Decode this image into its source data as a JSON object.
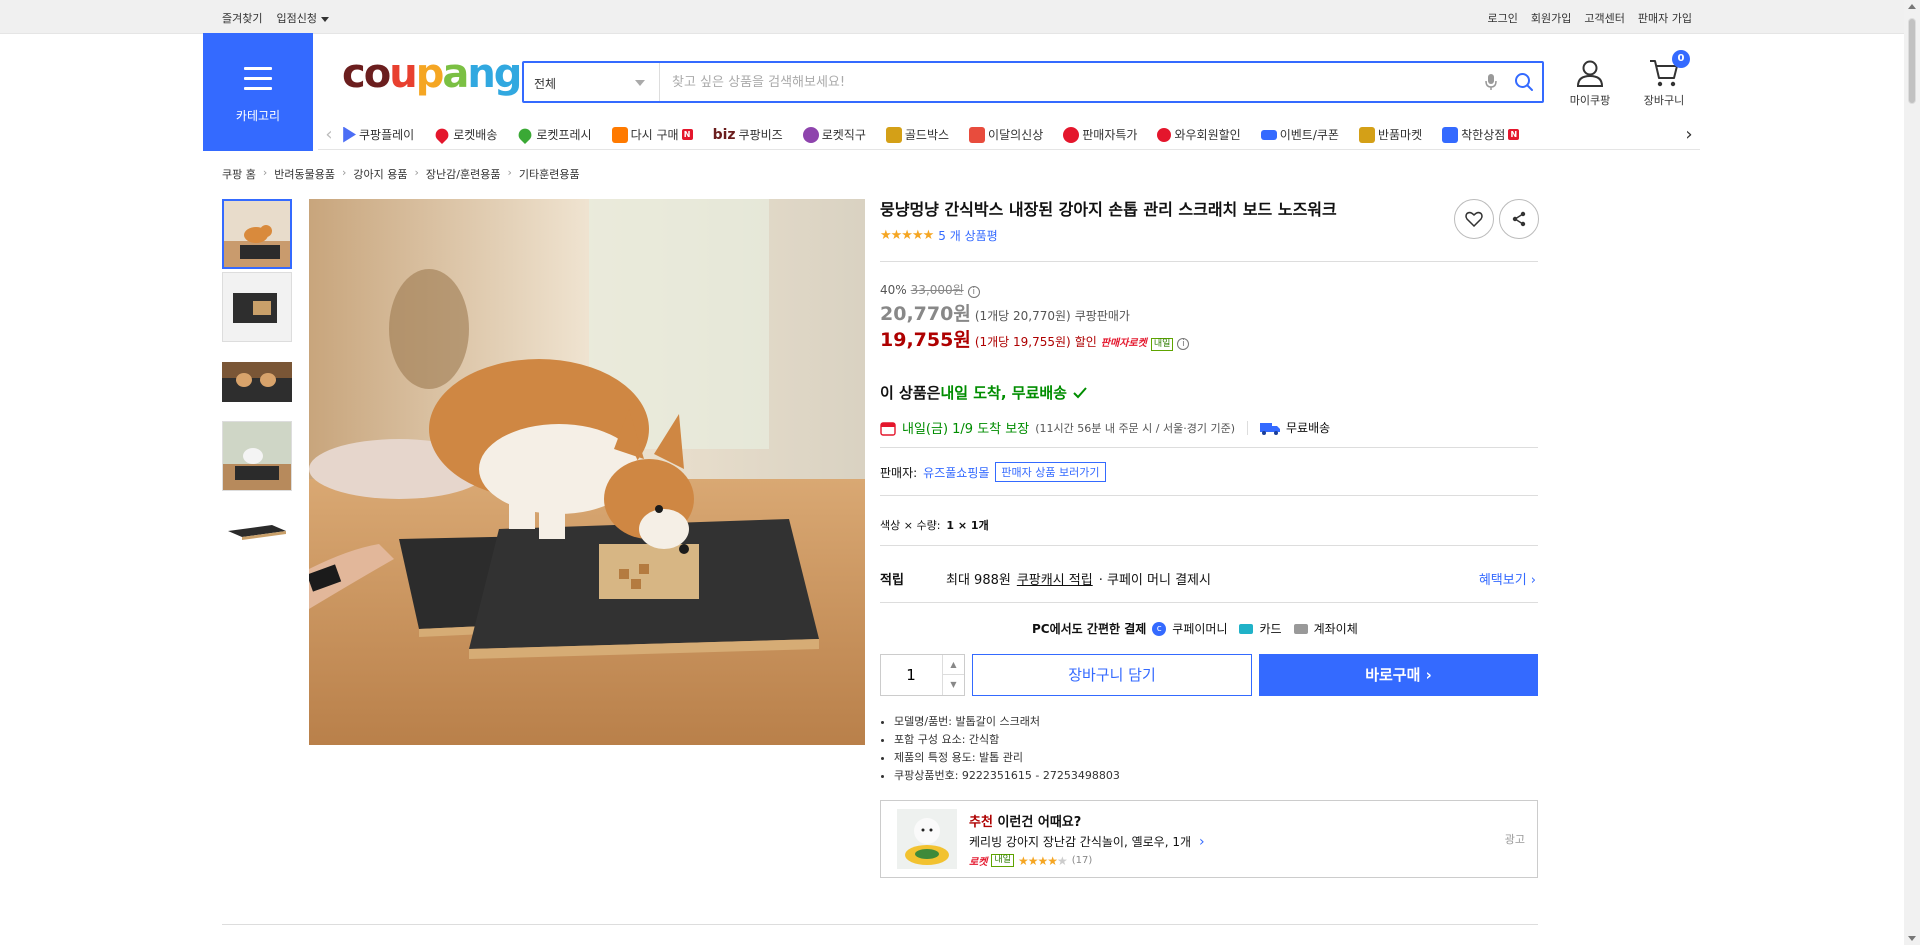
{
  "util": {
    "left": [
      "즐겨찾기",
      "입점신청"
    ],
    "right": [
      "로그인",
      "회원가입",
      "고객센터",
      "판매자 가입"
    ]
  },
  "header": {
    "category_label": "카테고리",
    "logo_text": "coupang",
    "search_select": "전체",
    "search_placeholder": "찾고 싶은 상품을 검색해보세요!",
    "mycoupang_label": "마이쿠팡",
    "cart_label": "장바구니",
    "cart_count": "0"
  },
  "subnav": [
    {
      "label": "쿠팡플레이",
      "icon": "play-icon",
      "color": "#4c6ef5"
    },
    {
      "label": "로켓배송",
      "icon": "rocket-icon",
      "color": "#e4162c"
    },
    {
      "label": "로켓프레시",
      "icon": "fresh-rocket-icon",
      "color": "#3aa935"
    },
    {
      "label": "다시 구매",
      "icon": "rebuy-icon",
      "color": "#ff7a00",
      "new": "N"
    },
    {
      "label": "쿠팡비즈",
      "icon": "biz-icon",
      "color": "#6b1e1e",
      "prefix": "biz"
    },
    {
      "label": "로켓직구",
      "icon": "global-rocket-icon",
      "color": "#8e44ad"
    },
    {
      "label": "골드박스",
      "icon": "goldbox-icon",
      "color": "#d4a017"
    },
    {
      "label": "이달의신상",
      "icon": "new-arrival-icon",
      "color": "#e84c3d"
    },
    {
      "label": "판매자특가",
      "icon": "seller-deal-icon",
      "color": "#e4162c"
    },
    {
      "label": "와우회원할인",
      "icon": "wow-icon",
      "color": "#e4162c"
    },
    {
      "label": "이벤트/쿠폰",
      "icon": "coupon-icon",
      "color": "#346aff"
    },
    {
      "label": "반품마켓",
      "icon": "return-market-icon",
      "color": "#d4a017"
    },
    {
      "label": "착한상점",
      "icon": "good-store-icon",
      "color": "#346aff",
      "new": "N"
    }
  ],
  "breadcrumb": [
    "쿠팡 홈",
    "반려동물용품",
    "강아지 용품",
    "장난감/훈련용품",
    "기타훈련용품"
  ],
  "product": {
    "title": "뭉냥멍냥 간식박스 내장된 강아지 손톱 관리 스크래치 보드 노즈워크",
    "stars": "★★★★★",
    "rating": 4.5,
    "review_count": "5 개 상품평",
    "discount_rate": "40%",
    "original_price": "33,000원",
    "price": "20,770원",
    "unit_price": "(1개당 20,770원)",
    "price_label": "쿠팡판매가",
    "sale_price": "19,755원",
    "sale_unit_price": "(1개당 19,755원)",
    "sale_label": "할인",
    "rocket_seller_tag": "판매자로켓",
    "tomorrow_tag": "내일",
    "delivery_head_prefix": "이 상품은 ",
    "delivery_head_green": "내일 도착, 무료배송",
    "delivery_date": "내일(금) 1/9 도착 보장",
    "delivery_note": "(11시간 56분 내 주문 시 / 서울·경기 기준)",
    "free_shipping": "무료배송",
    "seller_prefix": "판매자:",
    "seller_name": "유즈풀쇼핑몰",
    "seller_button": "판매자 상품 보러가기",
    "option_label": "색상 × 수량:",
    "option_value": "1 × 1개",
    "reward_label": "적립",
    "reward_text_1": "최대 988원",
    "reward_link": "쿠팡캐시 적립",
    "reward_text_2": "· 쿠페이 머니 결제시",
    "benefit_link": "혜택보기",
    "pay_title": "PC에서도 간편한 결제",
    "pay_methods": [
      "쿠페이머니",
      "카드",
      "계좌이체"
    ],
    "quantity": "1",
    "cart_button": "장바구니 담기",
    "buy_button": "바로구매",
    "attributes": [
      "모델명/품번: 발톱갈이 스크래처",
      "포함 구성 요소: 간식함",
      "제품의 특정 용도: 발톱 관리",
      "쿠팡상품번호: 9222351615 - 27253498803"
    ]
  },
  "recommend": {
    "head_red": "추천",
    "head_rest": " 이런건 어때요?",
    "item_name": "케리빙 강아지 장난감 간식놀이, 옐로우, 1개",
    "rocket": "로켓",
    "tomorrow": "내일",
    "stars": "★★★★",
    "star_empty": "★",
    "reviews": "(17)",
    "ad_label": "광고"
  }
}
